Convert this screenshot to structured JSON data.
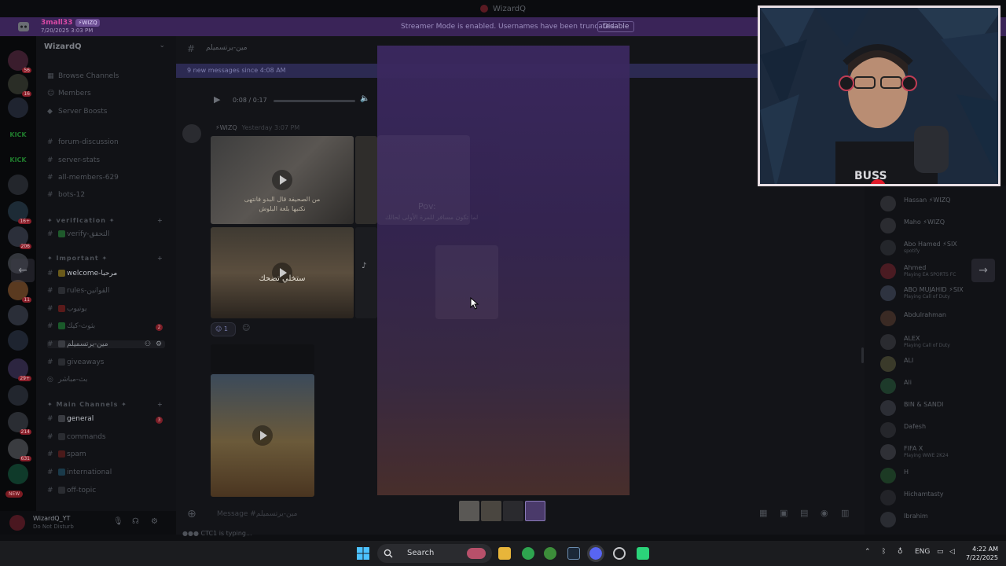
{
  "window": {
    "title": "WizardQ"
  },
  "banner": {
    "username": "3mall33",
    "tag": "⚡WIZQ",
    "datetime": "7/20/2025 3:03 PM",
    "message": "Streamer Mode is enabled. Usernames have been truncated.",
    "disable_label": "Disable"
  },
  "rail": {
    "badges": [
      "56",
      "16",
      "16+",
      "206",
      "11",
      "29+",
      "214",
      "631"
    ],
    "kick_label": "KICK",
    "new_label": "NEW"
  },
  "sidebar": {
    "server_name": "WizardQ",
    "nav": [
      "Browse Channels",
      "Members",
      "Server Boosts"
    ],
    "channels_top": [
      "forum-discussion",
      "server-stats",
      "all-members-629",
      "bots-12"
    ],
    "categories": [
      "verification",
      "Important",
      "Main Channels"
    ],
    "verify": "verify-التحقق",
    "important": [
      {
        "label": "welcome-مرحبا",
        "bright": true
      },
      {
        "label": "rules-القوانين",
        "bright": false
      },
      {
        "label": "يوتيوب",
        "bright": false
      },
      {
        "label": "بثوث-كيك",
        "bright": false,
        "unread": "2"
      },
      {
        "label": "مين-يرتسميلم",
        "bright": false,
        "active": true
      },
      {
        "label": "giveaways",
        "bright": false
      },
      {
        "label": "بث-مباشر",
        "bright": false
      }
    ],
    "main": [
      {
        "label": "general",
        "bright": true,
        "unread": "3"
      },
      {
        "label": "commands",
        "bright": false
      },
      {
        "label": "spam",
        "bright": false
      },
      {
        "label": "international",
        "bright": false
      },
      {
        "label": "off-topic",
        "bright": false
      }
    ]
  },
  "userpanel": {
    "name": "WizardQ_YT",
    "status": "Do Not Disturb"
  },
  "chat": {
    "channel_name": "مين-يرتسميلم",
    "new_messages": "9 new messages since 4:08 AM",
    "player_time": "0:08 / 0:17",
    "author_tag": "⚡WIZQ",
    "author_date": "Yesterday 3:07 PM",
    "caption1": "من الصحيفة قال البدو فانتهى",
    "caption1b": "نكتبها بلغة البلوش",
    "caption2": "ستخلي تضحك",
    "caption3": "Pov:",
    "caption3b": "لما تكون مسافر للمرة الأولى لحالك",
    "reaction_count": "1",
    "composer_placeholder": "Message #مين-يرتسميلم",
    "typing": "CTC1 is typing..."
  },
  "members": [
    {
      "name": "Hassan",
      "tag": "⚡WIZQ",
      "status": ""
    },
    {
      "name": "Maho",
      "tag": "⚡WIZQ",
      "status": ""
    },
    {
      "name": "Abo Hamed",
      "tag": "⚡SIX",
      "status": "spotify"
    },
    {
      "name": "Ahmed",
      "tag": "",
      "status": "Playing EA SPORTS FC"
    },
    {
      "name": "ABO MUJAHID",
      "tag": "⚡SIX",
      "status": "Playing Call of Duty"
    },
    {
      "name": "Abdulrahman",
      "tag": "",
      "status": ""
    },
    {
      "name": "ALEX",
      "tag": "",
      "status": "Playing Call of Duty"
    },
    {
      "name": "ALI",
      "tag": "",
      "status": ""
    },
    {
      "name": "Ali",
      "tag": "",
      "status": ""
    },
    {
      "name": "BIN & SANDI",
      "tag": "",
      "status": ""
    },
    {
      "name": "Dafesh",
      "tag": "",
      "status": ""
    },
    {
      "name": "FIFA X",
      "tag": "",
      "status": "Playing WWE 2K24"
    },
    {
      "name": "H",
      "tag": "",
      "status": ""
    },
    {
      "name": "Hichamtasty",
      "tag": "",
      "status": ""
    },
    {
      "name": "Ibrahim",
      "tag": "",
      "status": ""
    }
  ],
  "taskbar": {
    "search_label": "Search",
    "lang": "ENG",
    "time": "4:22 AM",
    "date": "7/22/2025"
  },
  "colors": {
    "banner": "#3a2458",
    "viewer_top": "#3b2860",
    "accent_red": "#8a1f2a"
  }
}
